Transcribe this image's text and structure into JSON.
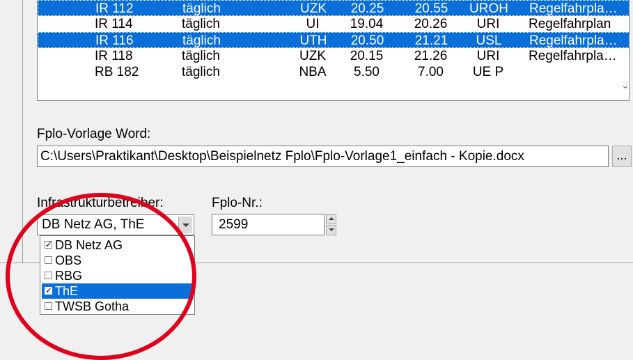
{
  "train_list": {
    "rows": [
      {
        "train": "IR 112",
        "days": "täglich",
        "from_code": "UZK",
        "dep": "20.25",
        "arr": "20.55",
        "to_code": "UROH",
        "type": "Regelfahrpla…",
        "selected": true
      },
      {
        "train": "IR 114",
        "days": "täglich",
        "from_code": "UI",
        "dep": "19.04",
        "arr": "20.26",
        "to_code": "URI",
        "type": "Regelfahrplan",
        "selected": false
      },
      {
        "train": "IR 116",
        "days": "täglich",
        "from_code": "UTH",
        "dep": "20.50",
        "arr": "21.21",
        "to_code": "USL",
        "type": "Regelfahrpla…",
        "selected": true
      },
      {
        "train": "IR 118",
        "days": "täglich",
        "from_code": "UZK",
        "dep": "20.15",
        "arr": "21.26",
        "to_code": "URI",
        "type": "Regelfahrpla…",
        "selected": false
      },
      {
        "train": "RB 182",
        "days": "täglich",
        "from_code": "NBA",
        "dep": "5.50",
        "arr": "7.00",
        "to_code": "UE  P",
        "type": "",
        "selected": false
      }
    ],
    "scroll_icon": "chevron-down-icon"
  },
  "template": {
    "label": "Fplo-Vorlage Word:",
    "path": "C:\\Users\\Praktikant\\Desktop\\Beispielnetz Fplo\\Fplo-Vorlage1_einfach - Kopie.docx",
    "browse_label": "..."
  },
  "operator": {
    "label": "Infrastrukturbetreiber:",
    "value": "DB Netz AG, ThE",
    "options": [
      {
        "label": "DB Netz AG",
        "checked": true,
        "highlighted": false
      },
      {
        "label": "OBS",
        "checked": false,
        "highlighted": false
      },
      {
        "label": "RBG",
        "checked": false,
        "highlighted": false
      },
      {
        "label": "ThE",
        "checked": true,
        "highlighted": true
      },
      {
        "label": "TWSB Gotha",
        "checked": false,
        "highlighted": false
      }
    ]
  },
  "fplo_nr": {
    "label": "Fplo-Nr.:",
    "value": "2599"
  },
  "colors": {
    "selection": "#0a6fd8",
    "annotation": "#e0001b"
  }
}
